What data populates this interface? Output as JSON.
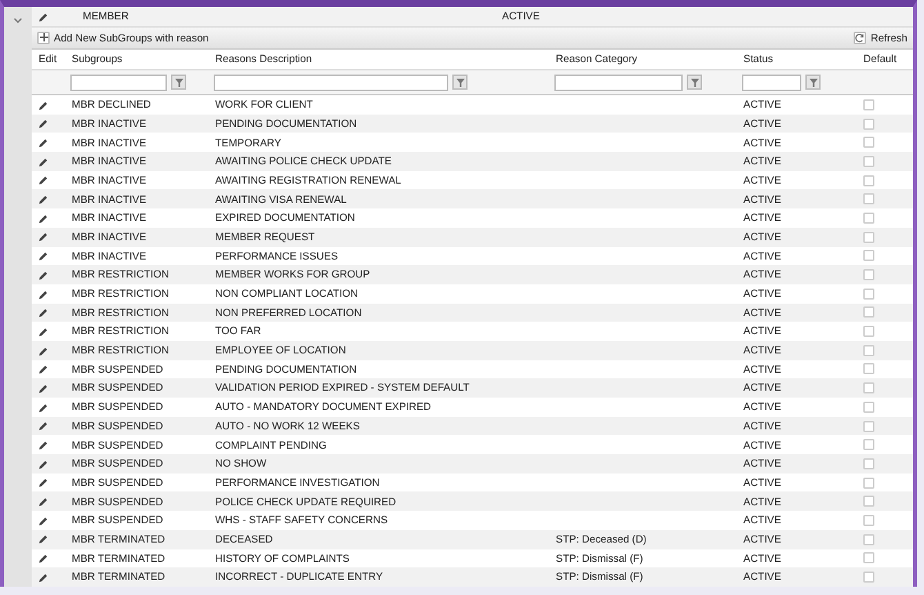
{
  "parent_row": {
    "expanded": true,
    "name": "MEMBER",
    "status": "ACTIVE"
  },
  "toolbar": {
    "add_button": "Add New SubGroups with reason",
    "refresh_button": "Refresh"
  },
  "table": {
    "columns": [
      {
        "label": "Edit",
        "filter": false
      },
      {
        "label": "Subgroups",
        "filter": true
      },
      {
        "label": "Reasons Description",
        "filter": true
      },
      {
        "label": "Reason Category",
        "filter": true
      },
      {
        "label": "Status",
        "filter": true
      },
      {
        "label": "Default",
        "filter": false
      }
    ],
    "rows": [
      {
        "subgroup": "MBR DECLINED",
        "reason": "WORK FOR CLIENT",
        "status": "ACTIVE",
        "checked": false
      },
      {
        "subgroup": "MBR INACTIVE",
        "reason": "PENDING DOCUMENTATION",
        "status": "ACTIVE",
        "checked": false
      },
      {
        "subgroup": "MBR INACTIVE",
        "reason": "TEMPORARY",
        "status": "ACTIVE",
        "checked": false
      },
      {
        "subgroup": "MBR INACTIVE",
        "reason": "AWAITING POLICE CHECK UPDATE",
        "status": "ACTIVE",
        "checked": false
      },
      {
        "subgroup": "MBR INACTIVE",
        "reason": "AWAITING REGISTRATION RENEWAL",
        "status": "ACTIVE",
        "checked": false
      },
      {
        "subgroup": "MBR INACTIVE",
        "reason": "AWAITING VISA RENEWAL",
        "status": "ACTIVE",
        "checked": false
      },
      {
        "subgroup": "MBR INACTIVE",
        "reason": "EXPIRED DOCUMENTATION",
        "status": "ACTIVE",
        "checked": false
      },
      {
        "subgroup": "MBR INACTIVE",
        "reason": "MEMBER REQUEST",
        "status": "ACTIVE",
        "checked": false
      },
      {
        "subgroup": "MBR INACTIVE",
        "reason": "PERFORMANCE ISSUES",
        "status": "ACTIVE",
        "checked": false
      },
      {
        "subgroup": "MBR RESTRICTION",
        "reason": "MEMBER WORKS FOR GROUP",
        "status": "ACTIVE",
        "checked": false
      },
      {
        "subgroup": "MBR RESTRICTION",
        "reason": "NON COMPLIANT LOCATION",
        "status": "ACTIVE",
        "checked": false
      },
      {
        "subgroup": "MBR RESTRICTION",
        "reason": "NON PREFERRED LOCATION",
        "status": "ACTIVE",
        "checked": false
      },
      {
        "subgroup": "MBR RESTRICTION",
        "reason": "TOO FAR",
        "status": "ACTIVE",
        "checked": false
      },
      {
        "subgroup": "MBR RESTRICTION",
        "reason": "EMPLOYEE OF LOCATION",
        "status": "ACTIVE",
        "checked": false
      },
      {
        "subgroup": "MBR SUSPENDED",
        "reason": "PENDING DOCUMENTATION",
        "status": "ACTIVE",
        "checked": false
      },
      {
        "subgroup": "MBR SUSPENDED",
        "reason": "VALIDATION PERIOD EXPIRED - SYSTEM DEFAULT",
        "status": "ACTIVE",
        "checked": false
      },
      {
        "subgroup": "MBR SUSPENDED",
        "reason": "AUTO - MANDATORY DOCUMENT EXPIRED",
        "status": "ACTIVE",
        "checked": false
      },
      {
        "subgroup": "MBR SUSPENDED",
        "reason": "AUTO - NO WORK 12 WEEKS",
        "status": "ACTIVE",
        "checked": false
      },
      {
        "subgroup": "MBR SUSPENDED",
        "reason": "COMPLAINT PENDING",
        "status": "ACTIVE",
        "checked": false
      },
      {
        "subgroup": "MBR SUSPENDED",
        "reason": "NO SHOW",
        "status": "ACTIVE",
        "checked": false
      },
      {
        "subgroup": "MBR SUSPENDED",
        "reason": "PERFORMANCE INVESTIGATION",
        "status": "ACTIVE",
        "checked": false
      },
      {
        "subgroup": "MBR SUSPENDED",
        "reason": "POLICE CHECK UPDATE REQUIRED",
        "status": "ACTIVE",
        "checked": false
      },
      {
        "subgroup": "MBR SUSPENDED",
        "reason": "WHS - STAFF SAFETY CONCERNS",
        "status": "ACTIVE",
        "checked": false
      },
      {
        "subgroup": "MBR TERMINATED",
        "reason": "DECEASED",
        "category": "STP: Deceased (D)",
        "status": "ACTIVE",
        "checked": false
      },
      {
        "subgroup": "MBR TERMINATED",
        "reason": "HISTORY OF COMPLAINTS",
        "category": "STP: Dismissal (F)",
        "status": "ACTIVE",
        "checked": false
      },
      {
        "subgroup": "MBR TERMINATED",
        "reason": "INCORRECT - DUPLICATE ENTRY",
        "category": "STP: Dismissal (F)",
        "status": "ACTIVE",
        "checked": false
      }
    ]
  }
}
